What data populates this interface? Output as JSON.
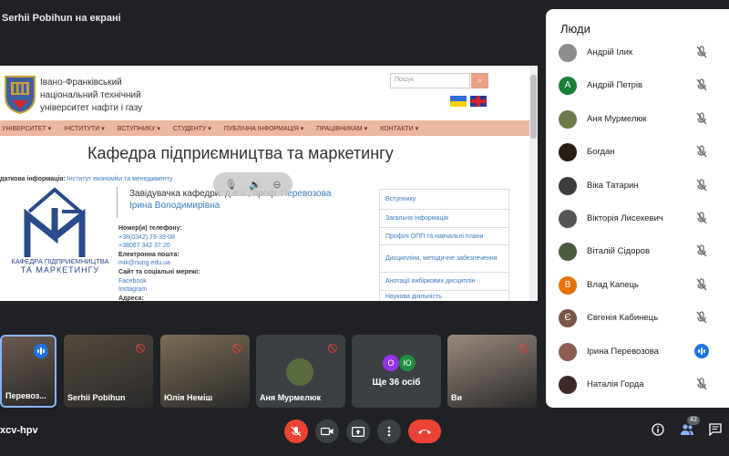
{
  "presenter": {
    "label": "Serhii Pobihun на екрані"
  },
  "shared_screen": {
    "university_name": [
      "Івано-Франківський",
      "національний технічний",
      "університет нафти і газу"
    ],
    "search_placeholder": "Пошук",
    "nav": [
      "УНІВЕРСИТЕТ ▾",
      "ІНСТИТУТИ ▾",
      "ВСТУПНИКУ ▾",
      "СТУДЕНТУ ▾",
      "ПУБЛІЧНА ІНФОРМАЦІЯ ▾",
      "ПРАЦІВНИКАМ ▾",
      "КОНТАКТИ ▾"
    ],
    "heading": "Кафедра підприємництва та маркетингу",
    "inst_label": "даткова інформація:",
    "inst_link": "Інститут економіки та менеджменту",
    "dept_logo_line1": "КАФЕДРА ПІДПРИЄМНИЦТВА",
    "dept_logo_line2": "ТА МАРКЕТИНГУ",
    "head_prefix": "Завідувачка кафедри: д.е.н., проф. ",
    "head_name": "Перевозова Ірина Володимирівна",
    "contacts": [
      {
        "text": "Номер(и) телефону:",
        "kind": "lbl"
      },
      {
        "text": "+38(0342) 78-39-08",
        "kind": "link"
      },
      {
        "text": "+38067 342 37 20",
        "kind": "link"
      },
      {
        "text": "Електронна пошта:",
        "kind": "lbl"
      },
      {
        "text": "mik@nung.edu.ua",
        "kind": "link"
      },
      {
        "text": "Сайт та соціальні мережі:",
        "kind": "lbl"
      },
      {
        "text": "Facebook",
        "kind": "link"
      },
      {
        "text": "Instagram",
        "kind": "link"
      },
      {
        "text": "Адреса:",
        "kind": "lbl"
      }
    ],
    "side_menu": [
      "Вступнику",
      "Загальна інформація",
      "Профілі ОПП та навчальні плани",
      "Дисципліни, методичне забезпечення",
      "Анотації вибіркових дисциплін",
      "Наукова діяльність"
    ]
  },
  "thumbnails": [
    {
      "name": "Перевоз...",
      "speaking": true,
      "bg": "#6b5a50"
    },
    {
      "name": "Serhii Pobihun",
      "speaking": false,
      "bg": "#54493f"
    },
    {
      "name": "Юлія Неміш",
      "speaking": false,
      "bg": "#7a6c58"
    },
    {
      "name": "Аня Мурмелюк",
      "speaking": false,
      "bg": "#3c4043"
    },
    {
      "name": "Ви",
      "speaking": false,
      "bg": "#9a8a80"
    }
  ],
  "more": {
    "label": "Ще 36 осіб",
    "avatars": [
      {
        "letter": "О",
        "color": "#9334e6"
      },
      {
        "letter": "Ю",
        "color": "#1e8e3e"
      }
    ]
  },
  "bottom_bar": {
    "meeting_code": "xcv-hpv",
    "people_count": "42"
  },
  "people_panel": {
    "title": "Люди",
    "people": [
      {
        "name": "Андрій Ілик",
        "avatar": "",
        "color": "#8d8d8d",
        "speaking": false
      },
      {
        "name": "Андрій Петрів",
        "avatar": "A",
        "color": "#188038",
        "speaking": false
      },
      {
        "name": "Аня Мурмелюк",
        "avatar": "",
        "color": "#6f7a4c",
        "speaking": false
      },
      {
        "name": "Богдан",
        "avatar": "",
        "color": "#2b1d14",
        "speaking": false
      },
      {
        "name": "Віка Татарин",
        "avatar": "",
        "color": "#3d3d3d",
        "speaking": false
      },
      {
        "name": "Вікторія Лисекевич",
        "avatar": "",
        "color": "#555555",
        "speaking": false
      },
      {
        "name": "Віталій Сідоров",
        "avatar": "",
        "color": "#4d5a3f",
        "speaking": false
      },
      {
        "name": "Влад Капець",
        "avatar": "В",
        "color": "#e8710a",
        "speaking": false
      },
      {
        "name": "Євгенія Кабинець",
        "avatar": "Є",
        "color": "#795548",
        "speaking": false
      },
      {
        "name": "Ірина Перевозова",
        "avatar": "",
        "color": "#8b5e52",
        "speaking": true
      },
      {
        "name": "Наталія Горда",
        "avatar": "",
        "color": "#3b2a28",
        "speaking": false
      }
    ]
  }
}
